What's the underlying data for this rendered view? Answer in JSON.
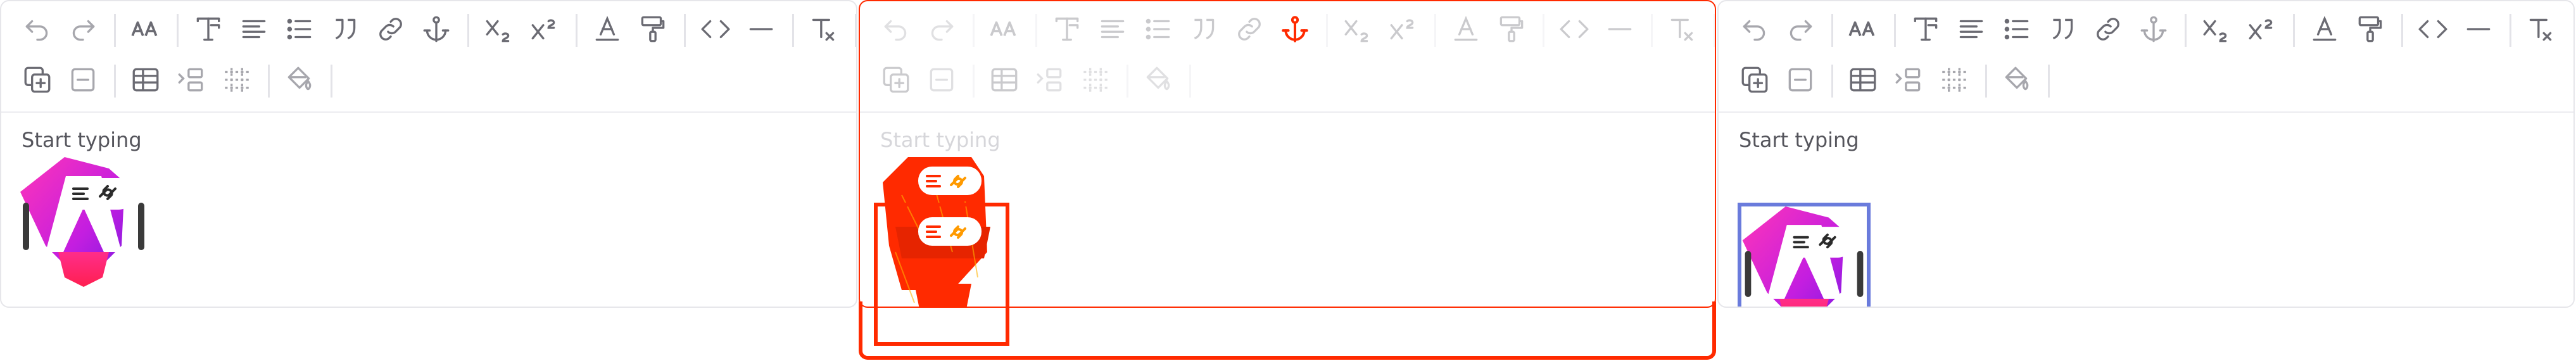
{
  "editor": {
    "placeholder": "Start typing"
  },
  "toolbar": {
    "row1": [
      {
        "name": "undo-button",
        "icon": "undo-icon"
      },
      {
        "name": "redo-button",
        "icon": "redo-icon"
      },
      {
        "name": "font-size-button",
        "icon": "font-size-icon"
      },
      {
        "name": "text-style-button",
        "icon": "text-style-icon"
      },
      {
        "name": "align-button",
        "icon": "align-left-icon"
      },
      {
        "name": "list-button",
        "icon": "bullet-list-icon"
      },
      {
        "name": "quote-button",
        "icon": "quote-icon"
      },
      {
        "name": "link-button",
        "icon": "link-icon"
      },
      {
        "name": "anchor-button",
        "icon": "anchor-icon"
      },
      {
        "name": "subscript-button",
        "icon": "subscript-icon"
      },
      {
        "name": "superscript-button",
        "icon": "superscript-icon"
      },
      {
        "name": "text-color-button",
        "icon": "text-color-icon"
      },
      {
        "name": "format-painter-button",
        "icon": "paint-roller-icon"
      },
      {
        "name": "code-button",
        "icon": "code-icon"
      },
      {
        "name": "horizontal-rule-button",
        "icon": "horizontal-rule-icon"
      },
      {
        "name": "clear-format-button",
        "icon": "clear-format-icon"
      }
    ],
    "row2": [
      {
        "name": "add-block-button",
        "icon": "add-block-icon"
      },
      {
        "name": "remove-block-button",
        "icon": "remove-block-icon"
      },
      {
        "name": "table-button",
        "icon": "table-icon"
      },
      {
        "name": "indent-button",
        "icon": "indent-icon"
      },
      {
        "name": "grid-button",
        "icon": "grid-icon"
      },
      {
        "name": "fill-color-button",
        "icon": "paint-bucket-icon"
      }
    ]
  },
  "colors": {
    "accent_selection": "#6a7bdc",
    "highlight_red": "#ff2a00",
    "icon_gray": "#6b6b73",
    "border": "#e6e6ea"
  }
}
